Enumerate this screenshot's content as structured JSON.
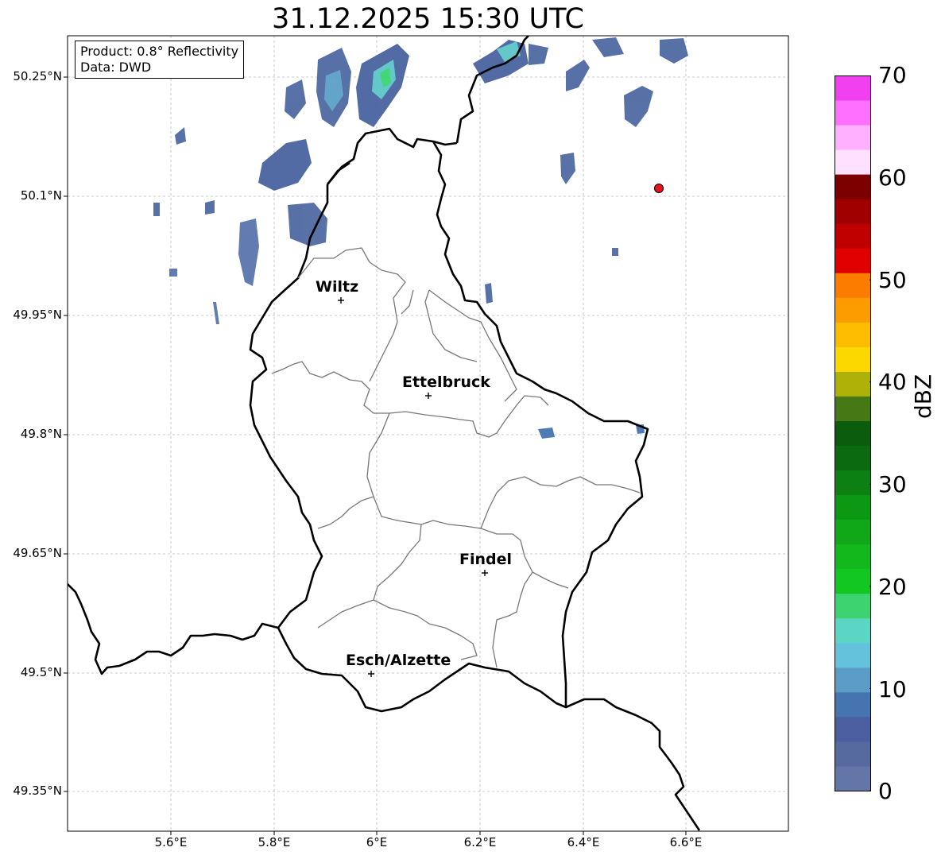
{
  "title": "31.12.2025 15:30 UTC",
  "info": {
    "product": "Product: 0.8° Reflectivity",
    "source": "Data: DWD"
  },
  "axes": {
    "y_ticks": [
      "50.25°N",
      "50.1°N",
      "49.95°N",
      "49.8°N",
      "49.65°N",
      "49.5°N",
      "49.35°N"
    ],
    "x_ticks": [
      "5.6°E",
      "5.8°E",
      "6°E",
      "6.2°E",
      "6.4°E",
      "6.6°E"
    ],
    "grid": true,
    "grid_style": "dashed"
  },
  "cities": [
    {
      "name": "Wiltz",
      "marker": "+"
    },
    {
      "name": "Ettelbruck",
      "marker": "+"
    },
    {
      "name": "Findel",
      "marker": "+"
    },
    {
      "name": "Esch/Alzette",
      "marker": "+"
    }
  ],
  "radar_site_marker": {
    "color": "#e6151c"
  },
  "colorbar": {
    "label": "dBZ",
    "ticks": [
      "0",
      "10",
      "20",
      "30",
      "40",
      "50",
      "60",
      "70"
    ],
    "colors": [
      "#6475a8",
      "#566aa0",
      "#4a5ea0",
      "#4574b0",
      "#5a9cc6",
      "#64c2dc",
      "#5cd6c4",
      "#3cd470",
      "#10c820",
      "#12b81c",
      "#10a818",
      "#0d9814",
      "#0c8012",
      "#0b6a10",
      "#0b5c0c",
      "#467816",
      "#aeb208",
      "#fcd800",
      "#fcbc00",
      "#fc9c00",
      "#fc7c00",
      "#e00000",
      "#c00000",
      "#a00000",
      "#7c0000",
      "#ffe0ff",
      "#ffb0ff",
      "#ff70ff",
      "#f040f0"
    ]
  }
}
